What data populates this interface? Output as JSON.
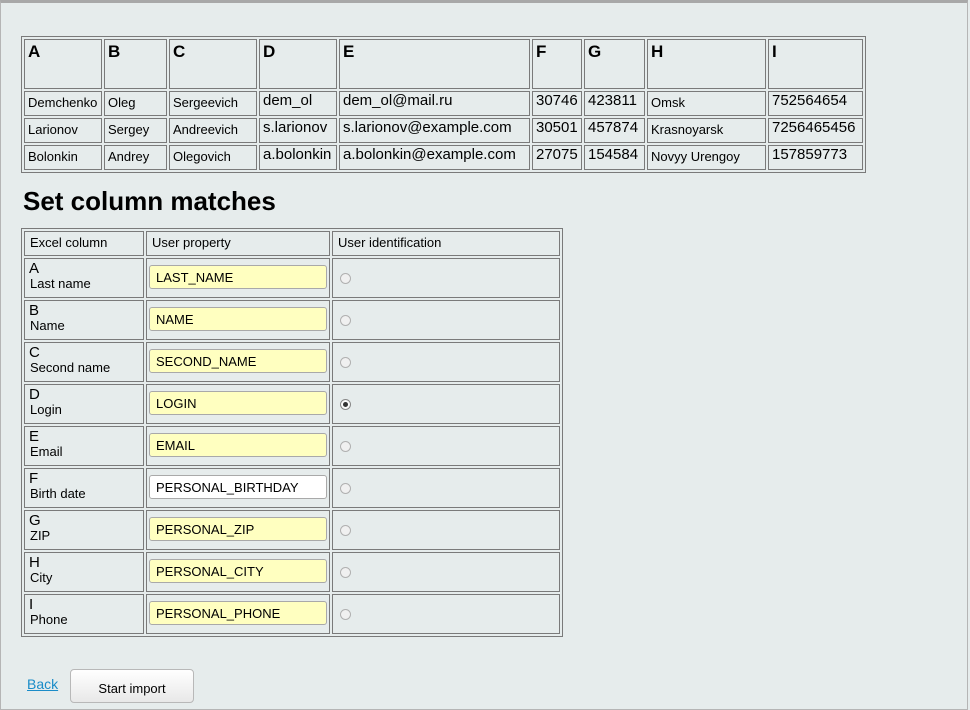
{
  "preview": {
    "headers": [
      "A",
      "B",
      "C",
      "D",
      "E",
      "F",
      "G",
      "H",
      "I"
    ],
    "rows": [
      [
        "Demchenko",
        "Oleg",
        "Sergeevich",
        "dem_ol",
        "dem_ol@mail.ru",
        "30746",
        "423811",
        "Omsk",
        "752564654"
      ],
      [
        "Larionov",
        "Sergey",
        "Andreevich",
        "s.larionov",
        "s.larionov@example.com",
        "30501",
        "457874",
        "Krasnoyarsk",
        "7256465456"
      ],
      [
        "Bolonkin",
        "Andrey",
        "Olegovich",
        "a.bolonkin",
        "a.bolonkin@example.com",
        "27075",
        "154584",
        "Novyy Urengoy",
        "157859773"
      ]
    ]
  },
  "mapping": {
    "title": "Set column matches",
    "headers": {
      "excel_column": "Excel column",
      "user_property": "User property",
      "user_identification": "User identification"
    },
    "rows": [
      {
        "letter": "A",
        "name": "Last name",
        "property": "LAST_NAME",
        "highlight": true,
        "selected": false
      },
      {
        "letter": "B",
        "name": "Name",
        "property": "NAME",
        "highlight": true,
        "selected": false
      },
      {
        "letter": "C",
        "name": "Second name",
        "property": "SECOND_NAME",
        "highlight": true,
        "selected": false
      },
      {
        "letter": "D",
        "name": "Login",
        "property": "LOGIN",
        "highlight": true,
        "selected": true
      },
      {
        "letter": "E",
        "name": "Email",
        "property": "EMAIL",
        "highlight": true,
        "selected": false
      },
      {
        "letter": "F",
        "name": "Birth date",
        "property": "PERSONAL_BIRTHDAY",
        "highlight": false,
        "selected": false
      },
      {
        "letter": "G",
        "name": "ZIP",
        "property": "PERSONAL_ZIP",
        "highlight": true,
        "selected": false
      },
      {
        "letter": "H",
        "name": "City",
        "property": "PERSONAL_CITY",
        "highlight": true,
        "selected": false
      },
      {
        "letter": "I",
        "name": "Phone",
        "property": "PERSONAL_PHONE",
        "highlight": true,
        "selected": false
      }
    ]
  },
  "actions": {
    "back_label": "Back",
    "start_label": "Start import"
  },
  "colors": {
    "background": "#e6ecec",
    "highlight_input": "#ffffc0",
    "link": "#1a8cc8"
  }
}
